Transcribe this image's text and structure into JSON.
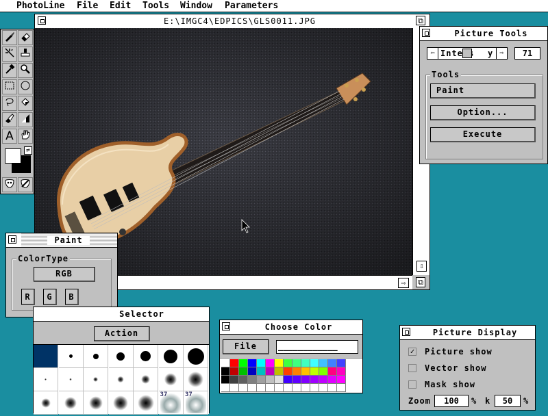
{
  "menubar": {
    "app_name": "PhotoLine",
    "items": [
      "File",
      "Edit",
      "Tools",
      "Window",
      "Parameters"
    ]
  },
  "image_window": {
    "title": "E:\\IMGC4\\EDPICS\\GLS0011.JPG",
    "scroll_up": "▲",
    "scroll_down": "⇩",
    "scroll_right": "⇨",
    "resize": "⧉"
  },
  "toolbox": {
    "tools": [
      "brush-icon",
      "eraser-icon",
      "sparkle-icon",
      "stamp-icon",
      "eyedropper-icon",
      "magnifier-icon",
      "rect-select-icon",
      "ellipse-select-icon",
      "lasso-icon",
      "bucket-icon",
      "smudge-icon",
      "gradient-icon",
      "text-icon",
      "hand-icon"
    ],
    "text_tool_glyph": "A"
  },
  "picture_tools": {
    "title": "Picture Tools",
    "slider_label": "Intens",
    "slider_suffix": "y",
    "slider_value": "71",
    "slider_fraction": 0.5,
    "group_label": "Tools",
    "paint_button": "Paint",
    "option_button": "Option...",
    "execute_button": "Execute"
  },
  "paint_panel": {
    "title": "Paint",
    "group_label": "ColorType",
    "mode_button": "RGB",
    "channels": [
      "R",
      "G",
      "B"
    ]
  },
  "selector": {
    "title": "Selector",
    "action_button": "Action",
    "label_37": "37"
  },
  "choose_color": {
    "title": "Choose Color",
    "file_button": "File",
    "name_field": "____________",
    "swatches": [
      [
        "#ffffff",
        "#ff0000",
        "#00ff00",
        "#0000ff",
        "#00ffff",
        "#ff00ff",
        "#ffff00",
        "#40ff40",
        "#40ff80",
        "#40ffc0",
        "#40ffff",
        "#40c0ff",
        "#4080ff",
        "#4040ff"
      ],
      [
        "#000000",
        "#c00000",
        "#00c000",
        "#0000c0",
        "#00c0c0",
        "#c000c0",
        "#c0c000",
        "#ff4000",
        "#ff8000",
        "#ffc000",
        "#c0ff00",
        "#80ff00",
        "#ff0080",
        "#ff00c0"
      ],
      [
        "#000000",
        "#404040",
        "#606060",
        "#808080",
        "#a0a0a0",
        "#c0c0c0",
        "#e0e0e0",
        "#4000ff",
        "#6000ff",
        "#8000ff",
        "#a000ff",
        "#c000ff",
        "#e000ff",
        "#ff00ff"
      ],
      [
        "#ffffff",
        "#ffffff",
        "#ffffff",
        "#ffffff",
        "#ffffff",
        "#ffffff",
        "#ffffff",
        "#ffffff",
        "#ffffff",
        "#ffffff",
        "#ffffff",
        "#ffffff",
        "#ffffff",
        "#ffffff"
      ]
    ]
  },
  "picture_display": {
    "title": "Picture Display",
    "options": [
      {
        "label": "Picture show",
        "checked": true
      },
      {
        "label": "Vector show",
        "checked": false
      },
      {
        "label": "Mask show",
        "checked": false
      }
    ],
    "check_glyph": "✓",
    "zoom_label": "Zoom",
    "zoom_value": "100",
    "percent1": "%",
    "k_label": "k",
    "k_value": "50",
    "percent2": "%"
  },
  "colors": {
    "desktop": "#1a8ea0",
    "window_bg": "#c0c0c0",
    "selected_brush": "#003366"
  }
}
